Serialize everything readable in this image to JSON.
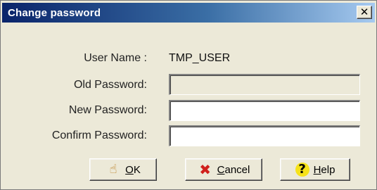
{
  "window": {
    "title": "Change password",
    "close_glyph": "✕"
  },
  "form": {
    "user_name_label": "User Name :",
    "user_name_value": "TMP_USER",
    "old_password_label": "Old Password:",
    "new_password_label": "New Password:",
    "confirm_password_label": "Confirm Password:",
    "old_password_value": "",
    "new_password_value": "",
    "confirm_password_value": ""
  },
  "buttons": {
    "ok": {
      "label_first": "O",
      "label_rest": "K",
      "icon": "hand-pointer-icon"
    },
    "cancel": {
      "label_first": "C",
      "label_rest": "ancel",
      "icon": "red-x-icon"
    },
    "help": {
      "label_first": "H",
      "label_rest": "elp",
      "icon": "question-mark-icon"
    }
  },
  "colors": {
    "titlebar_start": "#0a246a",
    "titlebar_end": "#a6caf0",
    "dialog_bg": "#ece9d8",
    "cancel_icon": "#d0201c",
    "help_icon_bg": "#f6e21a"
  }
}
